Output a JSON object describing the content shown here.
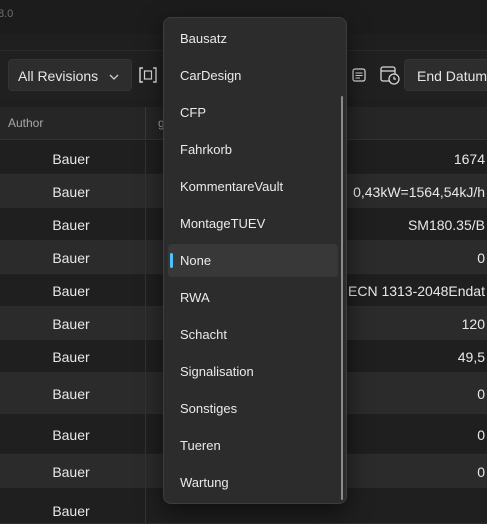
{
  "app": {
    "version_fragment": "8.0"
  },
  "toolbar": {
    "revision_filter": "All Revisions",
    "end_date_label": "End Datum"
  },
  "grid": {
    "columns": {
      "author": "Author",
      "next_fragment": "g"
    },
    "rows": [
      {
        "author": "Bauer",
        "value": "1674"
      },
      {
        "author": "Bauer",
        "value": "0,43kW=1564,54kJ/h"
      },
      {
        "author": "Bauer",
        "value": "SM180.35/B"
      },
      {
        "author": "Bauer",
        "value": "0"
      },
      {
        "author": "Bauer",
        "value": "ECN 1313-2048Endat"
      },
      {
        "author": "Bauer",
        "value": "120"
      },
      {
        "author": "Bauer",
        "value": "49,5"
      },
      {
        "author": "Bauer",
        "value": "0"
      },
      {
        "author": "Bauer",
        "value": "0"
      },
      {
        "author": "Bauer",
        "value": "0"
      },
      {
        "author": "Bauer",
        "value": ""
      }
    ]
  },
  "dropdown": {
    "items": [
      "Bausatz",
      "CarDesign",
      "CFP",
      "Fahrkorb",
      "KommentareVault",
      "MontageTUEV",
      "None",
      "RWA",
      "Schacht",
      "Signalisation",
      "Sonstiges",
      "Tueren",
      "Wartung"
    ],
    "selected": "None"
  },
  "colors": {
    "accent": "#4cc2ff",
    "background": "#1f1f1f",
    "flyout": "#2c2c2c"
  },
  "icons": [
    "chevron-down-icon",
    "frame-select-icon",
    "calendar-icon",
    "calendar-clock-icon"
  ]
}
